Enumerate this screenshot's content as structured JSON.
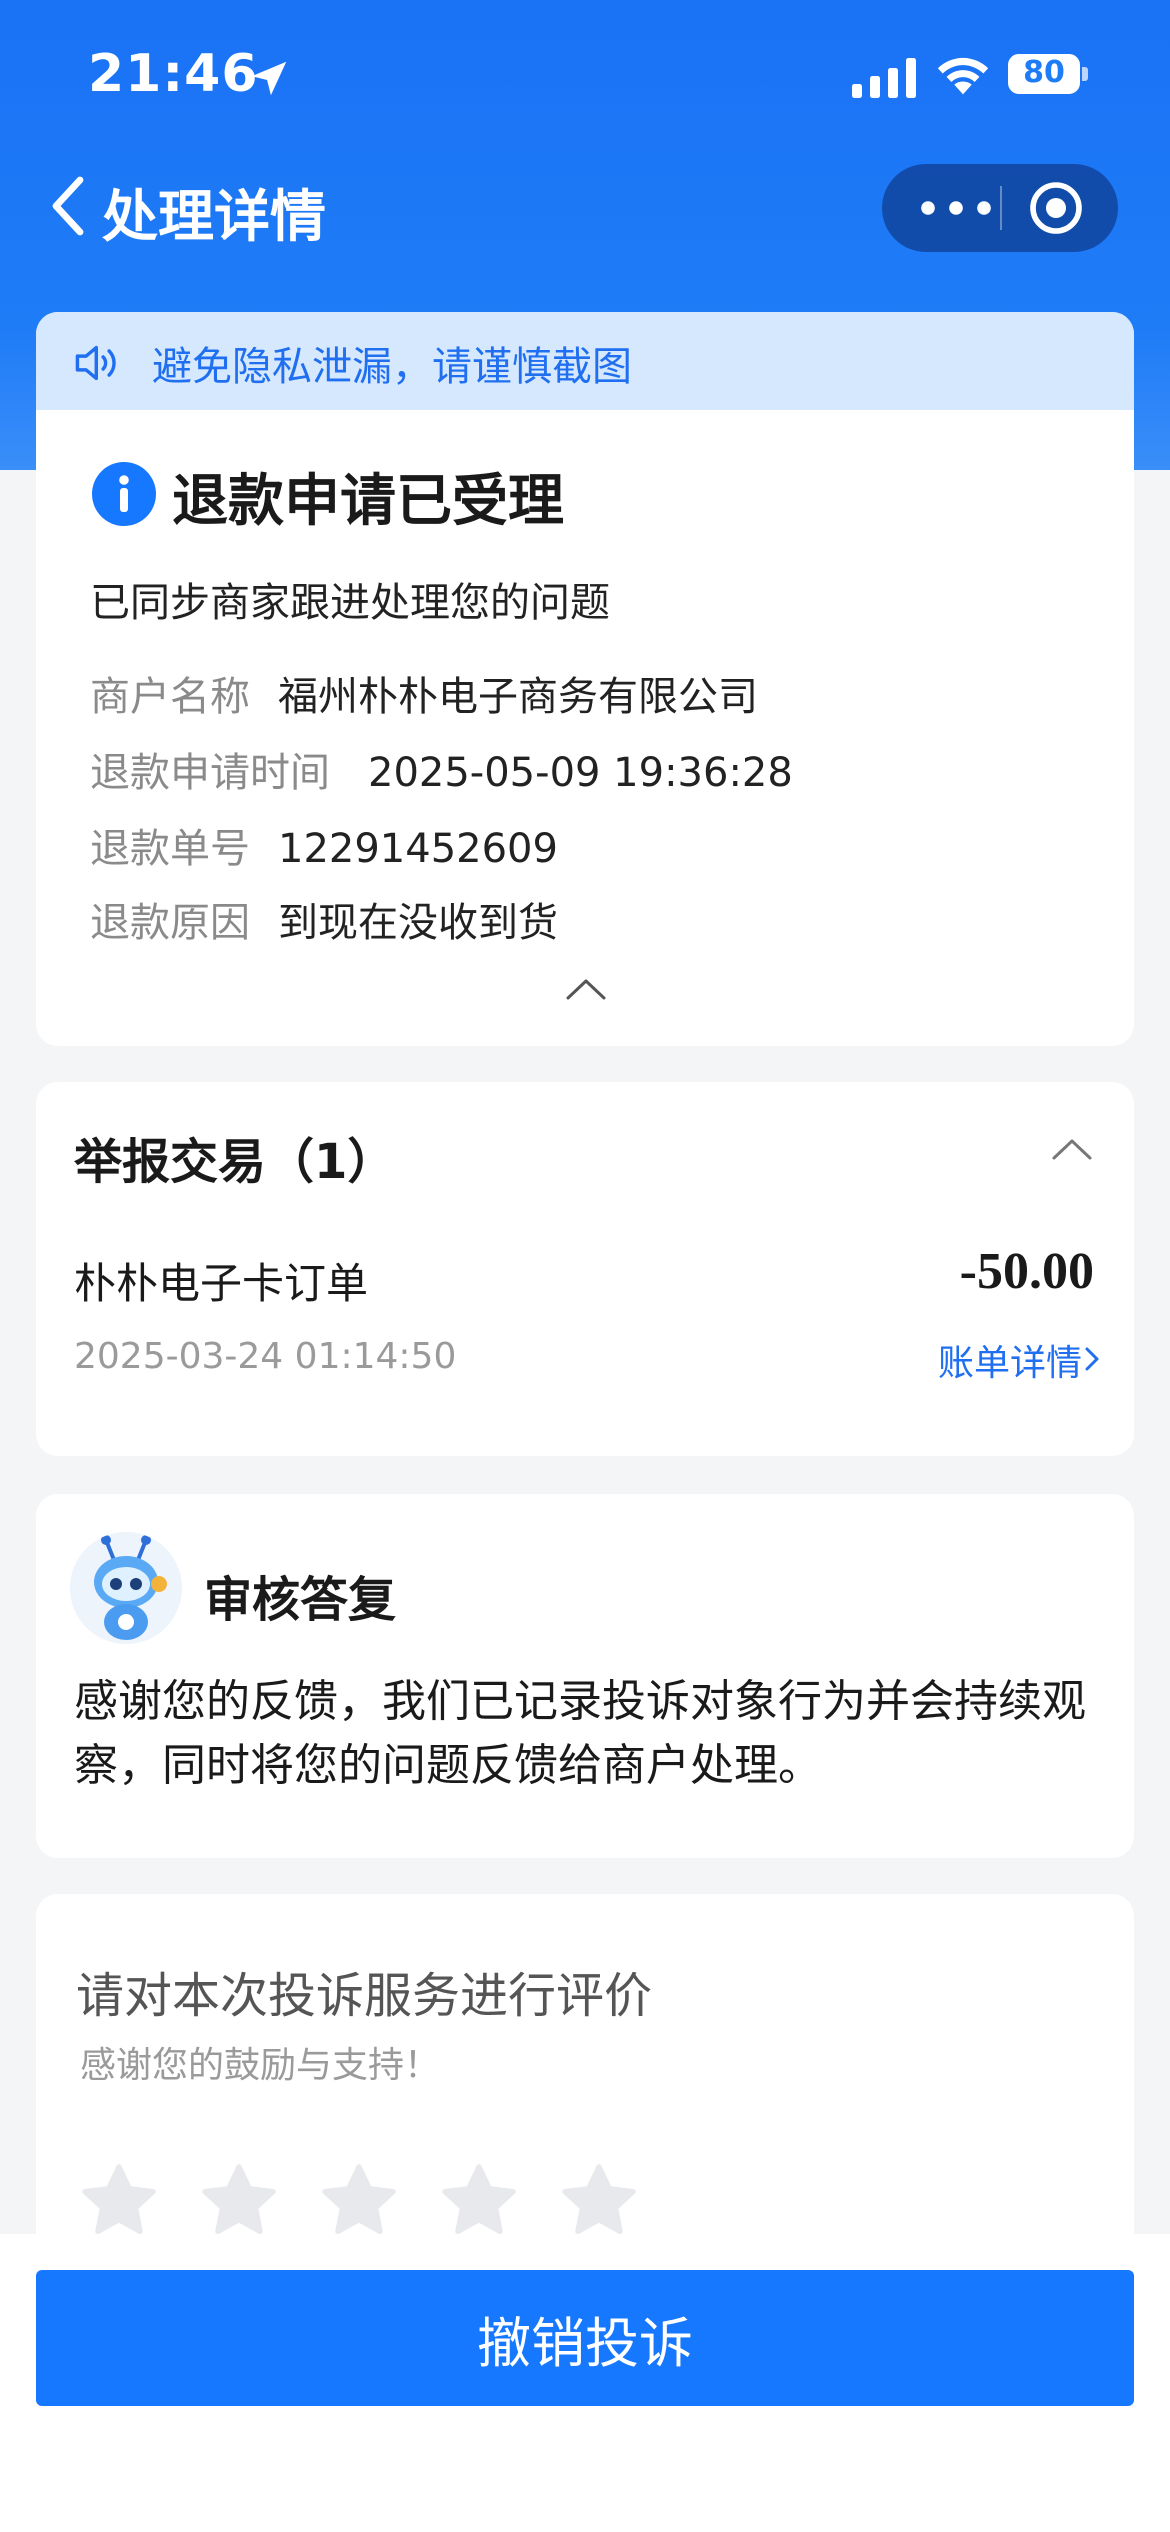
{
  "status_bar": {
    "time": "21:46",
    "battery": "80"
  },
  "nav": {
    "title": "处理详情"
  },
  "privacy_banner": {
    "text": "避免隐私泄漏，请谨慎截图"
  },
  "refund": {
    "status_title": "退款申请已受理",
    "subtitle": "已同步商家跟进处理您的问题",
    "fields": [
      {
        "label": "商户名称",
        "value": "福州朴朴电子商务有限公司"
      },
      {
        "label": "退款申请时间",
        "value": "2025-05-09 19:36:28"
      },
      {
        "label": "退款单号",
        "value": "12291452609"
      },
      {
        "label": "退款原因",
        "value": "到现在没收到货"
      }
    ]
  },
  "report": {
    "title": "举报交易（1）",
    "order_name": "朴朴电子卡订单",
    "amount": "-50.00",
    "time": "2025-03-24 01:14:50",
    "bill_link": "账单详情"
  },
  "review": {
    "title": "审核答复",
    "text": "感谢您的反馈，我们已记录投诉对象行为并会持续观察，同时将您的问题反馈给商户处理。"
  },
  "rating": {
    "title": "请对本次投诉服务进行评价",
    "subtitle": "感谢您的鼓励与支持！",
    "stars_total": 5,
    "stars_selected": 0
  },
  "footer": {
    "revoke_label": "撤销投诉"
  },
  "colors": {
    "brand_blue": "#1677ff",
    "link_blue": "#1f6ff0",
    "banner_bg": "#d6e8fe"
  },
  "icons": [
    "location-arrow-icon",
    "signal-icon",
    "wifi-icon",
    "battery-icon",
    "back-chevron-icon",
    "more-icon",
    "target-icon",
    "speaker-icon",
    "info-icon",
    "chevron-up-icon",
    "chevron-right-icon",
    "robot-avatar-icon",
    "star-icon"
  ]
}
